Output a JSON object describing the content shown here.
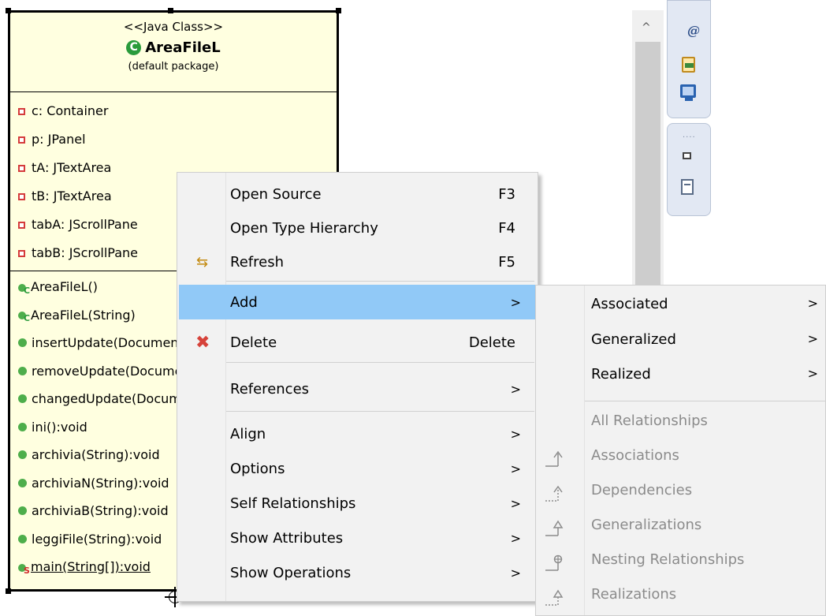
{
  "uml_class": {
    "stereotype": "<<Java Class>>",
    "name": "AreaFileL",
    "class_icon_glyph": "C",
    "package": "(default package)",
    "attributes": [
      "c: Container",
      "p: JPanel",
      "tA: JTextArea",
      "tB: JTextArea",
      "tabA: JScrollPane",
      "tabB: JScrollPane"
    ],
    "constructors": [
      {
        "label": "AreaFileL()",
        "badge": "C"
      },
      {
        "label": "AreaFileL(String)",
        "badge": "C"
      }
    ],
    "operations": [
      "insertUpdate(Document",
      "removeUpdate(Document",
      "changedUpdate(Document",
      "ini():void",
      "archivia(String):void",
      "archiviaN(String):void",
      "archiviaB(String):void",
      "leggiFile(String):void"
    ],
    "static_operation": {
      "label": "main(String[]):void",
      "badge": "S"
    }
  },
  "side_toolbar": {
    "icons": [
      "at-sign-icon",
      "java-doc-icon",
      "console-icon",
      "restore-window-icon",
      "outline-document-icon"
    ],
    "at_glyph": "@",
    "dots": "....",
    "scroll_up_glyph": "^"
  },
  "context_menu": {
    "items": [
      {
        "label": "Open Source",
        "shortcut": "F3"
      },
      {
        "label": "Open Type Hierarchy",
        "shortcut": "F4"
      },
      {
        "label": "Refresh",
        "shortcut": "F5",
        "icon": "refresh-icon"
      },
      {
        "label": "Add",
        "submenu": true,
        "highlighted": true
      },
      {
        "label": "Delete",
        "shortcut": "Delete",
        "icon": "delete-icon"
      },
      {
        "label": "References",
        "submenu": true
      },
      {
        "label": "Align",
        "submenu": true
      },
      {
        "label": "Options",
        "submenu": true
      },
      {
        "label": "Self Relationships",
        "submenu": true
      },
      {
        "label": "Show Attributes",
        "submenu": true
      },
      {
        "label": "Show Operations",
        "submenu": true
      }
    ],
    "arrow_glyph": ">",
    "refresh_glyph": "⇆",
    "delete_glyph": "✖"
  },
  "add_submenu": {
    "items": [
      {
        "label": "Associated",
        "submenu": true
      },
      {
        "label": "Generalized",
        "submenu": true
      },
      {
        "label": "Realized",
        "submenu": true
      },
      {
        "label": "All Relationships",
        "disabled": true
      },
      {
        "label": "Associations",
        "disabled": true,
        "icon": "association-icon"
      },
      {
        "label": "Dependencies",
        "disabled": true,
        "icon": "dependency-icon"
      },
      {
        "label": "Generalizations",
        "disabled": true,
        "icon": "generalization-icon"
      },
      {
        "label": "Nesting Relationships",
        "disabled": true,
        "icon": "nesting-icon"
      },
      {
        "label": "Realizations",
        "disabled": true,
        "icon": "realization-icon"
      }
    ]
  },
  "colors": {
    "class_fill": "#ffffe0",
    "menu_highlight": "#91c9f7",
    "disabled_text": "#8b8b8b"
  }
}
